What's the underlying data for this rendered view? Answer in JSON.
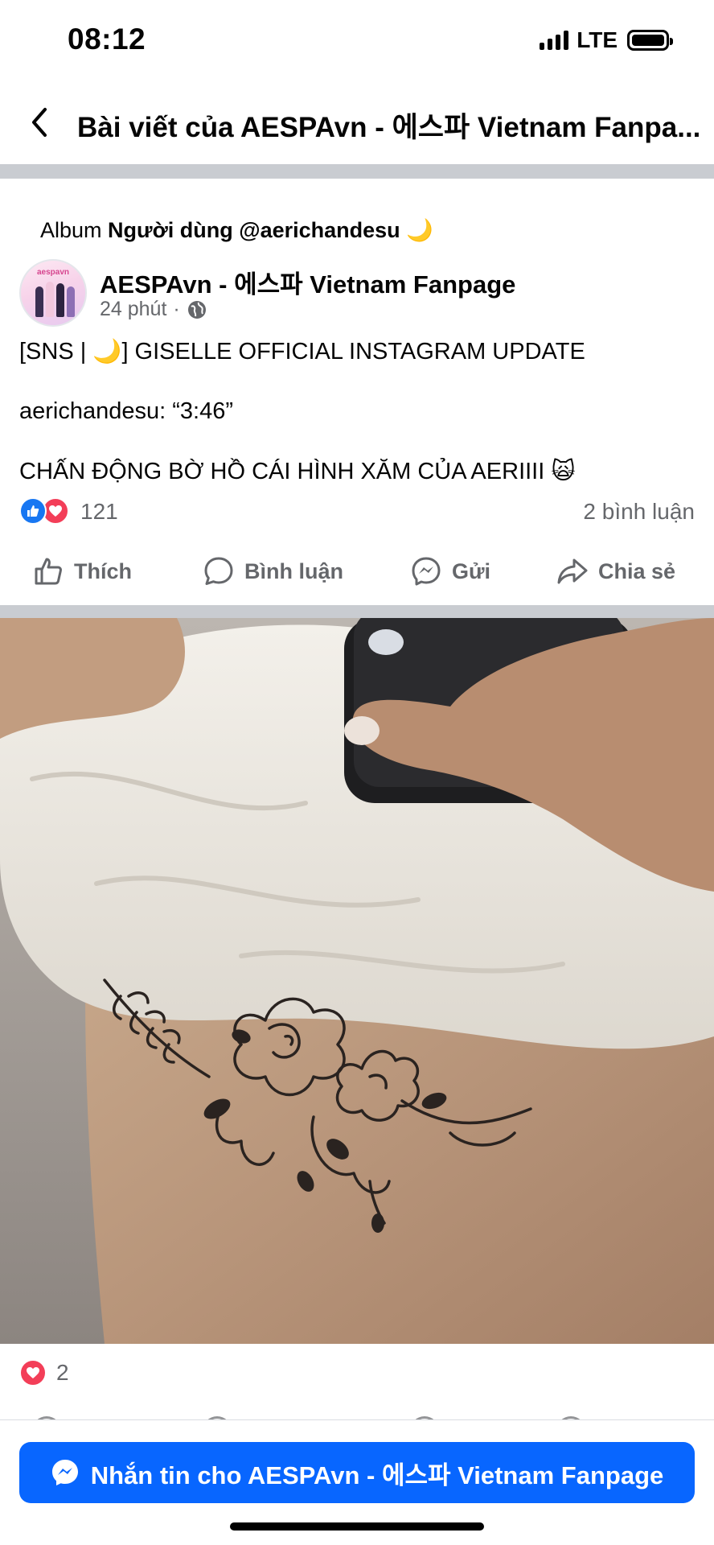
{
  "status_bar": {
    "time": "08:12",
    "network": "LTE",
    "icons": [
      "signal-icon",
      "battery-icon"
    ]
  },
  "header": {
    "title": "Bài viết của AESPAvn - 에스파 Vietnam Fanpa...",
    "back_icon": "chevron-left-icon"
  },
  "post": {
    "album_prefix": "Album",
    "album_name": "Người dùng @aerichandesu 🌙",
    "avatar_text": "aespavn",
    "page_name": "AESPAvn - 에스파 Vietnam Fanpage",
    "time_ago": "24 phút",
    "meta_separator": "·",
    "privacy_icon": "globe-icon",
    "text_lines": [
      "[SNS | 🌙] GISELLE OFFICIAL INSTAGRAM UPDATE",
      "aerichandesu: “3:46”",
      "CHẤN ĐỘNG BỜ HỒ CÁI HÌNH XĂM CỦA AERIIII 🙀"
    ],
    "reaction_count": "121",
    "comment_count": "2 bình luận",
    "actions": [
      {
        "label": "Thích",
        "icon": "like-icon"
      },
      {
        "label": "Bình luận",
        "icon": "comment-icon"
      },
      {
        "label": "Gửi",
        "icon": "messenger-icon"
      },
      {
        "label": "Chia sẻ",
        "icon": "share-icon"
      }
    ]
  },
  "photo": {
    "reaction_count": "2"
  },
  "message_button": {
    "label": "Nhắn tin cho AESPAvn - 에스파 Vietnam Fanpage"
  },
  "colors": {
    "brand_blue": "#0866ff",
    "like_blue": "#1877f2",
    "love_red": "#f33e58",
    "secondary_text": "#65676b",
    "divider": "#c9ccd1"
  }
}
